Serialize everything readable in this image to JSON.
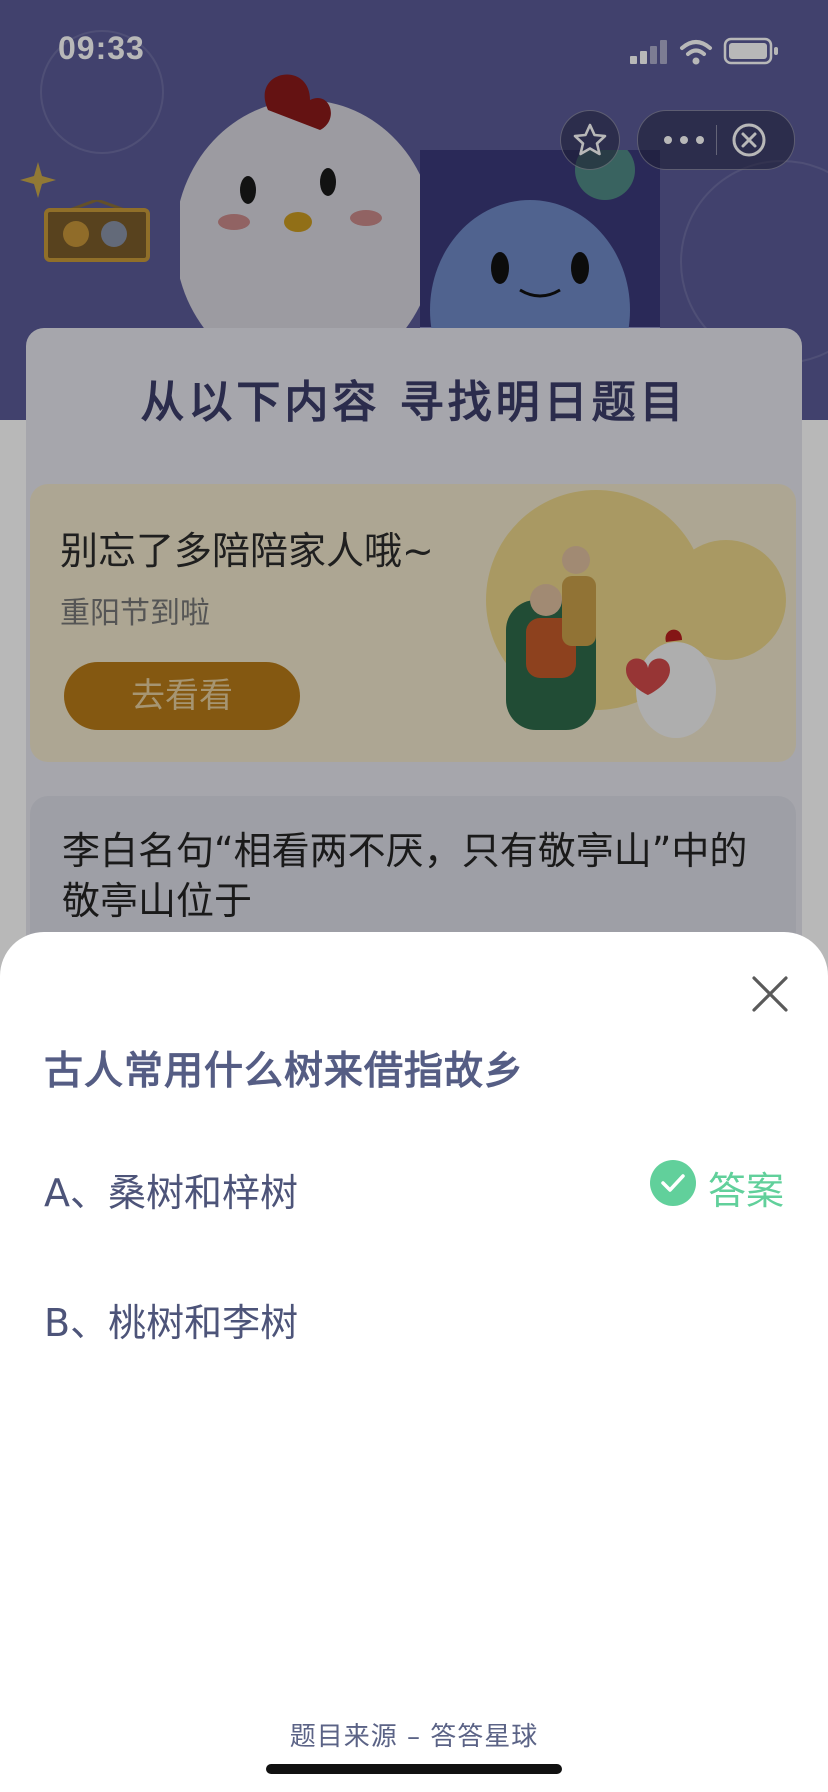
{
  "status_bar": {
    "time": "09:33"
  },
  "background_page": {
    "section_title": "从以下内容 寻找明日题目",
    "promo_card": {
      "title": "别忘了多陪陪家人哦~",
      "subtitle": "重阳节到啦",
      "button_label": "去看看"
    },
    "question_card": {
      "text": "李白名句“相看两不厌，只有敬亭山”中的敬亭山位于"
    }
  },
  "sheet": {
    "question": "古人常用什么树来借指故乡",
    "options": [
      {
        "label": "A、桑树和梓树",
        "is_answer": true
      },
      {
        "label": "B、桃树和李树",
        "is_answer": false
      }
    ],
    "answer_label": "答案",
    "footer": "题目来源 – 答答星球"
  },
  "colors": {
    "accent_green": "#61d09b",
    "question_text": "#555d84",
    "hero_bg": "#5a5b98",
    "promo_button": "#b87b18"
  },
  "icons": [
    "star-icon",
    "more-icon",
    "close-circle-icon",
    "close-icon",
    "check-icon",
    "signal-icon",
    "wifi-icon",
    "battery-icon"
  ]
}
